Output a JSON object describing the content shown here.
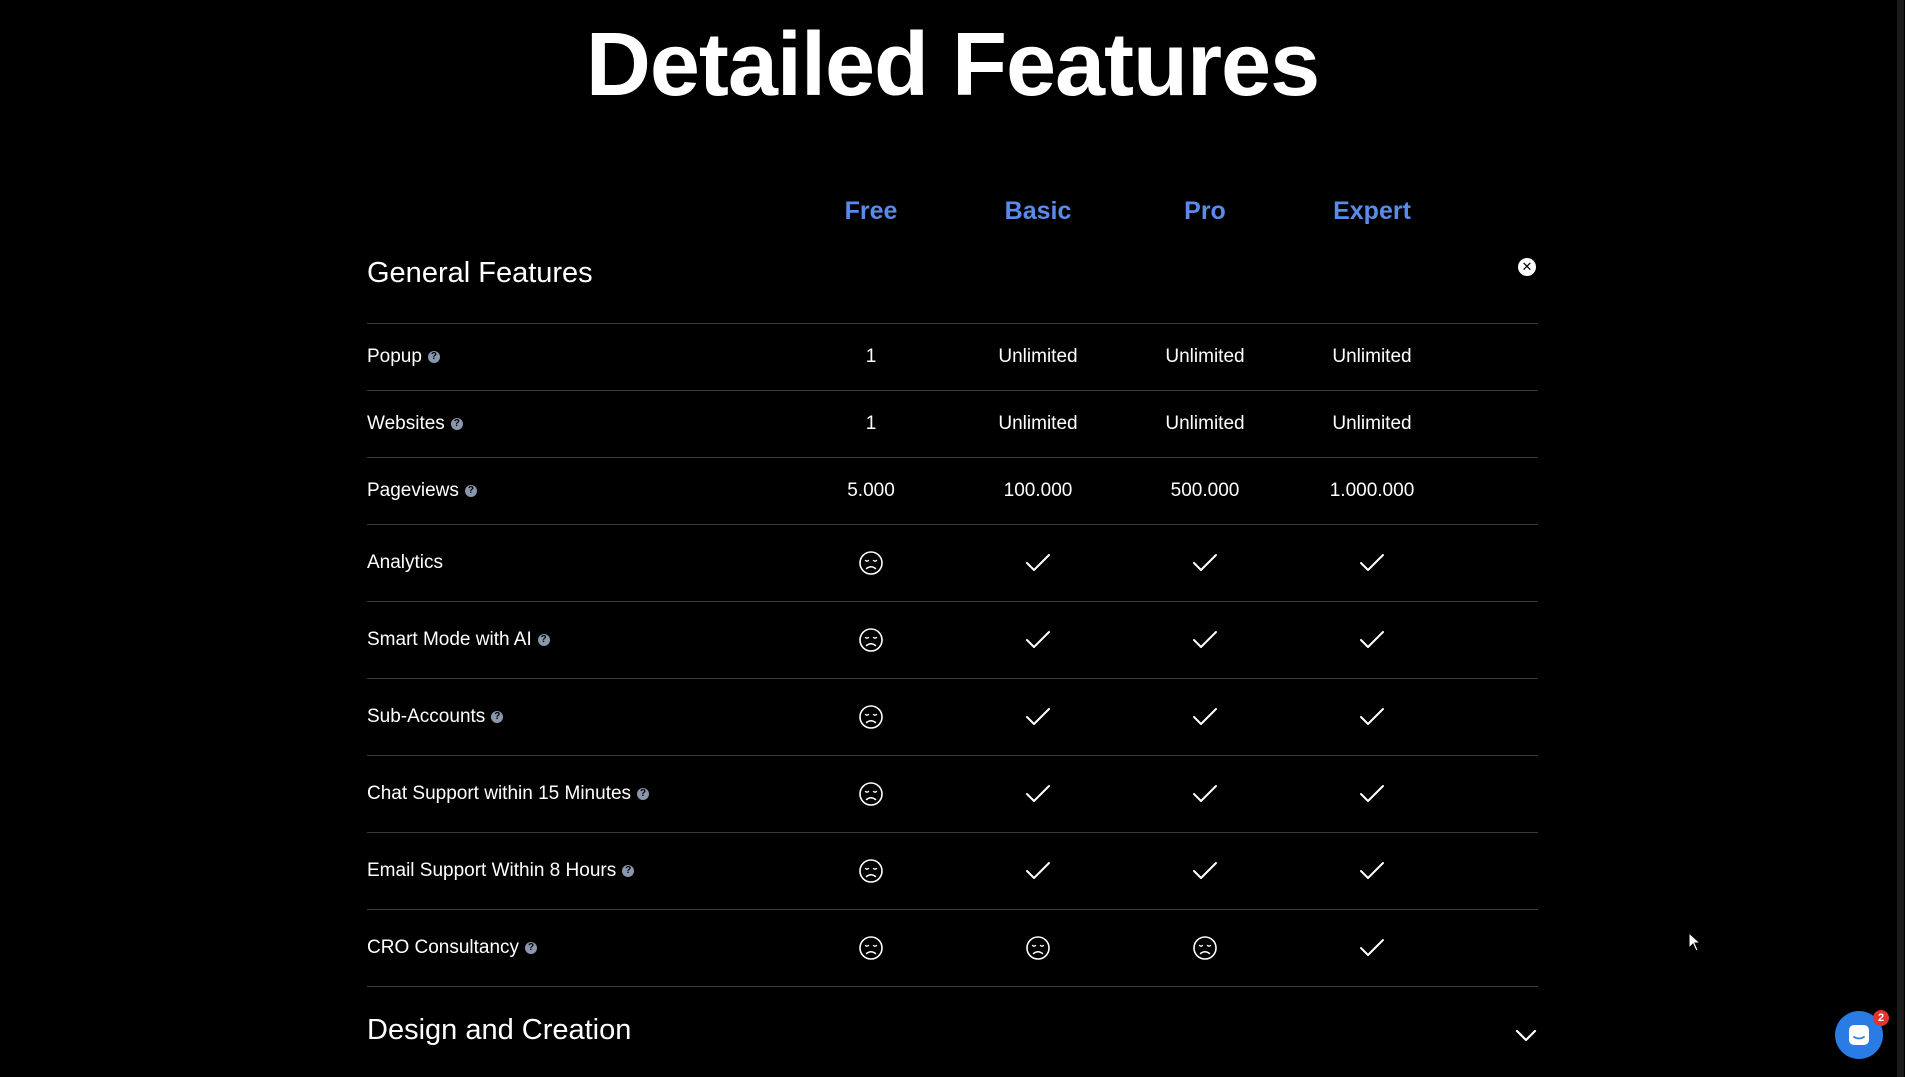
{
  "page": {
    "title": "Detailed Features"
  },
  "plans": [
    "Free",
    "Basic",
    "Pro",
    "Expert"
  ],
  "colors": {
    "plan_accent": "#5b8bea",
    "background": "#000000",
    "chat_launcher": "#2a7be4",
    "badge": "#e2352f"
  },
  "sections": {
    "general": {
      "title": "General Features",
      "state": "expanded",
      "toggle_icon": "close-circle-icon"
    },
    "design": {
      "title": "Design and Creation",
      "state": "collapsed",
      "toggle_icon": "chevron-down-icon"
    }
  },
  "features": [
    {
      "label": "Popup",
      "help": true,
      "values": [
        "1",
        "Unlimited",
        "Unlimited",
        "Unlimited"
      ]
    },
    {
      "label": "Websites",
      "help": true,
      "values": [
        "1",
        "Unlimited",
        "Unlimited",
        "Unlimited"
      ]
    },
    {
      "label": "Pageviews",
      "help": true,
      "values": [
        "5.000",
        "100.000",
        "500.000",
        "1.000.000"
      ]
    },
    {
      "label": "Analytics",
      "help": false,
      "values": [
        "sad-face-icon",
        "check-icon",
        "check-icon",
        "check-icon"
      ]
    },
    {
      "label": "Smart Mode with AI",
      "help": true,
      "values": [
        "sad-face-icon",
        "check-icon",
        "check-icon",
        "check-icon"
      ]
    },
    {
      "label": "Sub-Accounts",
      "help": true,
      "values": [
        "sad-face-icon",
        "check-icon",
        "check-icon",
        "check-icon"
      ]
    },
    {
      "label": "Chat Support within 15 Minutes",
      "help": true,
      "values": [
        "sad-face-icon",
        "check-icon",
        "check-icon",
        "check-icon"
      ]
    },
    {
      "label": "Email Support Within 8 Hours",
      "help": true,
      "values": [
        "sad-face-icon",
        "check-icon",
        "check-icon",
        "check-icon"
      ]
    },
    {
      "label": "CRO Consultancy",
      "help": true,
      "values": [
        "sad-face-icon",
        "sad-face-icon",
        "sad-face-icon",
        "check-icon"
      ]
    }
  ],
  "chat": {
    "icon": "chat-icon",
    "unread_count": "2"
  }
}
